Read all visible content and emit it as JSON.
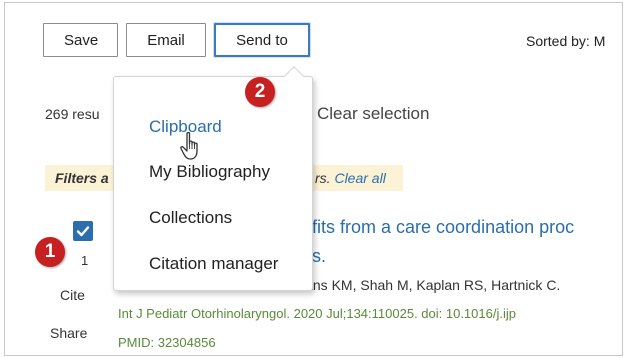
{
  "toolbar": {
    "save_label": "Save",
    "email_label": "Email",
    "send_to_label": "Send to",
    "sorted_text": "Sorted by: M"
  },
  "results": {
    "count_text": "269 resu",
    "clear_selection": "Clear selection"
  },
  "filters": {
    "left_text": "Filters a",
    "right_text": "rs.",
    "clear_all": "Clear all"
  },
  "send_to_menu": {
    "items": [
      {
        "label": "Clipboard"
      },
      {
        "label": "My Bibliography"
      },
      {
        "label": "Collections"
      },
      {
        "label": "Citation manager"
      }
    ]
  },
  "badges": {
    "step1": "1",
    "step2": "2"
  },
  "result_item": {
    "number": "1",
    "cite": "Cite",
    "share": "Share",
    "title_line1": "efits from a care coordination proc",
    "title_line2": "es.",
    "authors": "lans KM, Shah M, Kaplan RS, Hartnick C.",
    "journal": "Int J Pediatr Otorhinolaryngol. 2020 Jul;134:110025. doi: 10.1016/j.ijp",
    "pmid": "PMID: 32304856"
  },
  "colors": {
    "accent": "#2a6ead",
    "badge": "#c62020",
    "filter_bg": "#fcf2d6",
    "citation_green": "#5a8a3a"
  }
}
